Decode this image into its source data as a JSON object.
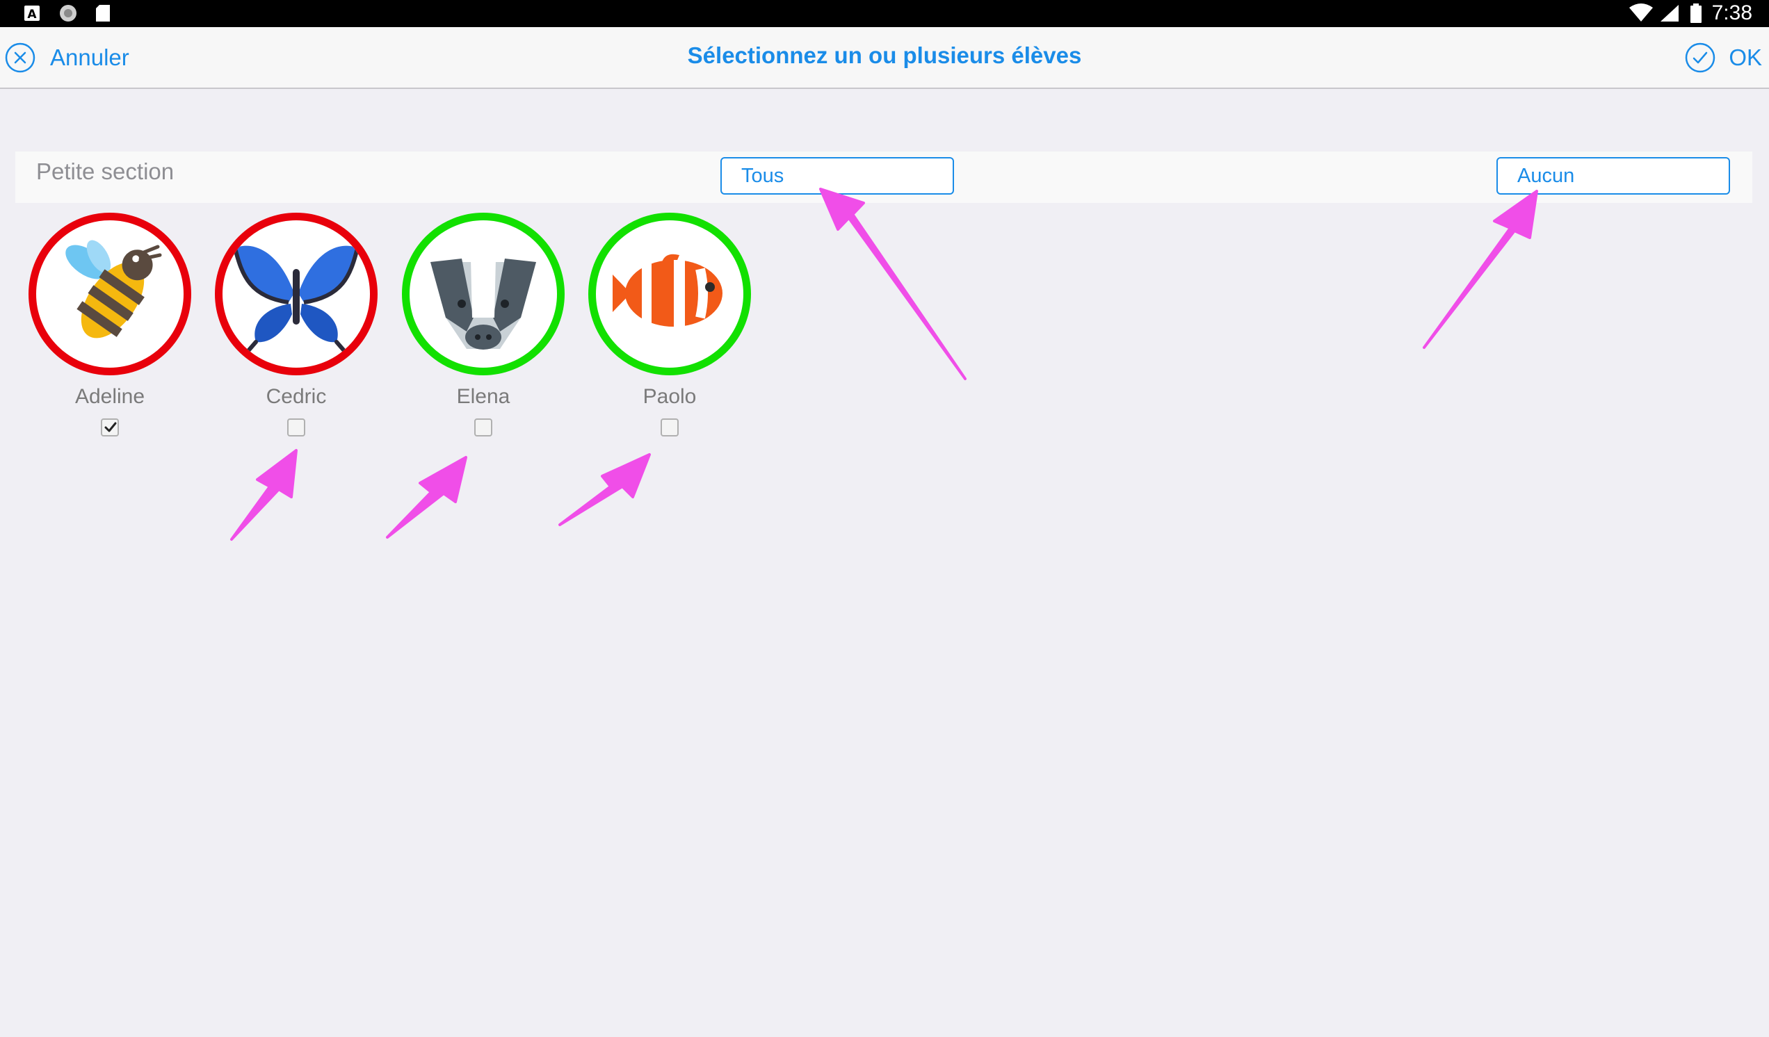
{
  "status_bar": {
    "time": "7:38",
    "left_icons": [
      "font-badge-icon",
      "circle-icon",
      "sd-card-icon"
    ],
    "right_icons": [
      "wifi-icon",
      "cell-signal-icon",
      "battery-icon"
    ]
  },
  "nav": {
    "cancel_label": "Annuler",
    "title": "Sélectionnez un ou plusieurs élèves",
    "ok_label": "OK"
  },
  "section": {
    "title": "Petite section",
    "select_all_label": "Tous",
    "select_none_label": "Aucun"
  },
  "students": [
    {
      "name": "Adeline",
      "icon": "bee-icon",
      "checked": true,
      "ring_color": "#e8000b"
    },
    {
      "name": "Cedric",
      "icon": "butterfly-icon",
      "checked": false,
      "ring_color": "#e8000b"
    },
    {
      "name": "Elena",
      "icon": "badger-icon",
      "checked": false,
      "ring_color": "#12e000"
    },
    {
      "name": "Paolo",
      "icon": "clownfish-icon",
      "checked": false,
      "ring_color": "#12e000"
    }
  ],
  "colors": {
    "accent": "#1a8ce8",
    "annotation_arrow": "#f04ee8",
    "background": "#f0eff4"
  }
}
